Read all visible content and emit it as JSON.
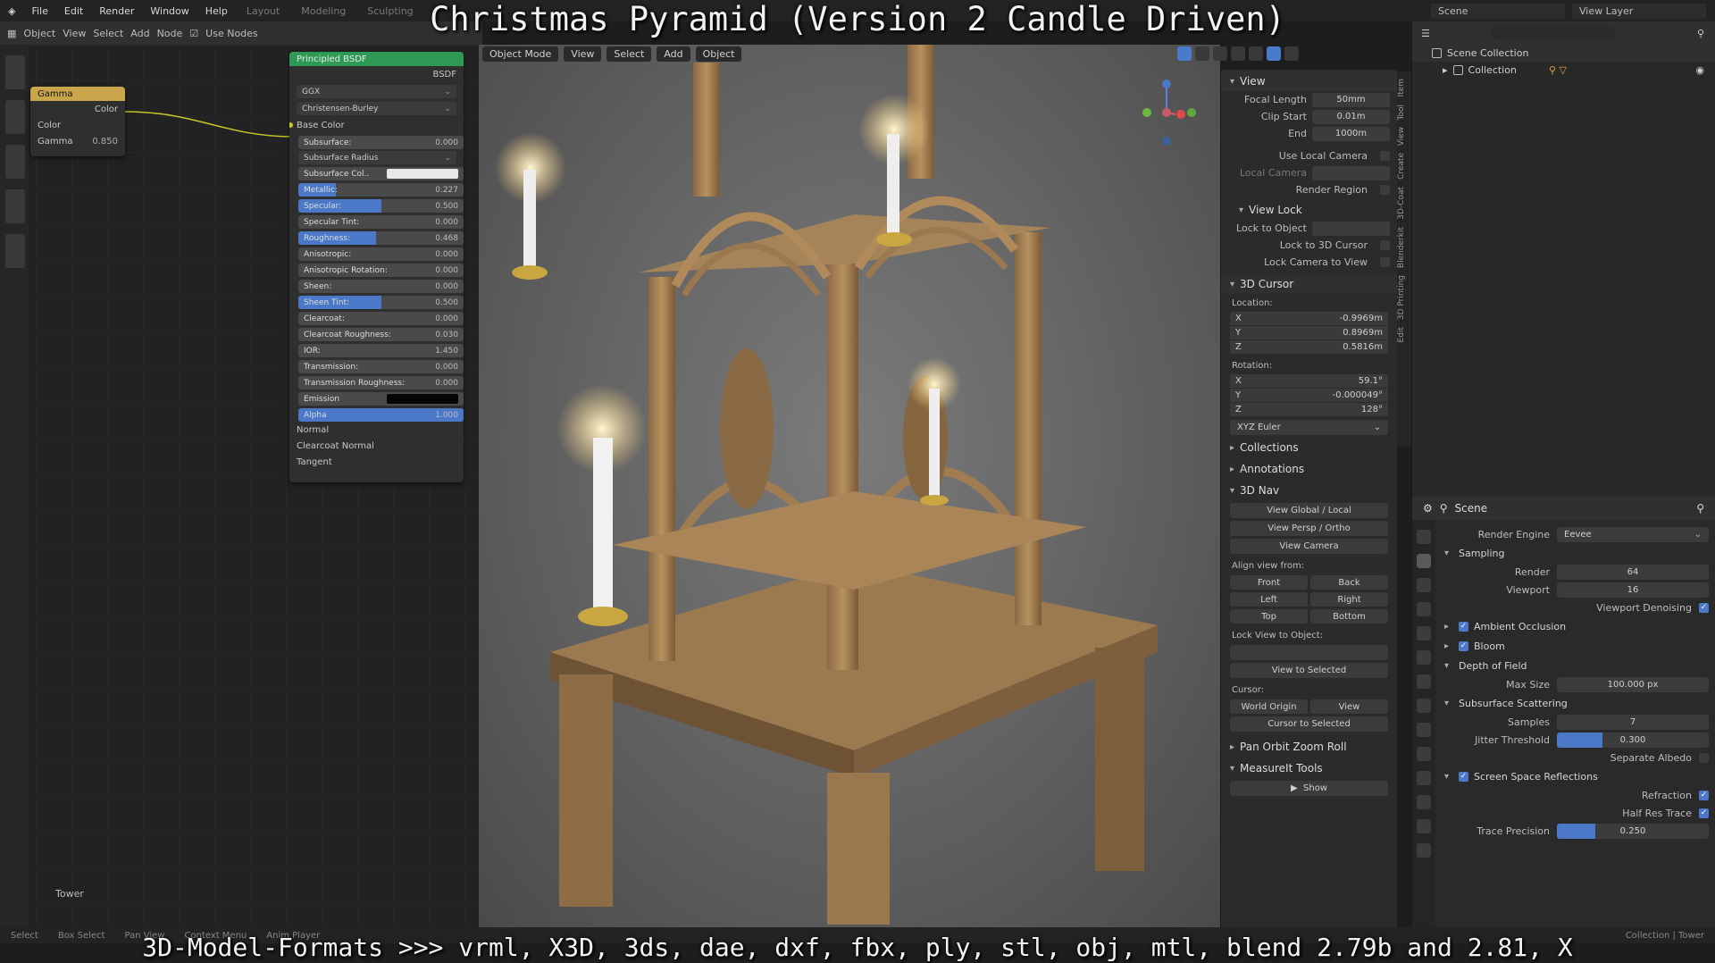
{
  "overlay": {
    "title": "Christmas Pyramid (Version 2 Candle Driven)",
    "caption": "3D-Model-Formats >>> vrml, X3D, 3ds, dae, dxf, fbx, ply, stl, obj, mtl, blend 2.79b and 2.81, X"
  },
  "topbar": {
    "menu": [
      "File",
      "Edit",
      "Render",
      "Window",
      "Help"
    ],
    "workspaces": [
      "Layout",
      "Modeling",
      "Sculpting"
    ],
    "scene": "Scene",
    "view_layer": "View Layer"
  },
  "node_editor": {
    "header": [
      "Object",
      "View",
      "Select",
      "Add",
      "Node",
      "Use Nodes"
    ],
    "gamma_node": {
      "title": "Gamma",
      "output": "Color",
      "input": "Color",
      "gamma_label": "Gamma",
      "gamma_value": "0.850"
    },
    "bsdf_node": {
      "title": "Principled BSDF",
      "output": "BSDF",
      "distribution": "GGX",
      "subsurface_method": "Christensen-Burley",
      "base_color": "Base Color",
      "rows": [
        {
          "label": "Subsurface:",
          "value": "0.000",
          "fill": 0
        },
        {
          "label": "Subsurface Col..",
          "value": "",
          "fill": 0
        },
        {
          "label": "Metallic:",
          "value": "0.227",
          "fill": 0.227
        },
        {
          "label": "Specular:",
          "value": "0.500",
          "fill": 0.5
        },
        {
          "label": "Specular Tint:",
          "value": "0.000",
          "fill": 0
        },
        {
          "label": "Roughness:",
          "value": "0.468",
          "fill": 0.468
        },
        {
          "label": "Anisotropic:",
          "value": "0.000",
          "fill": 0
        },
        {
          "label": "Anisotropic Rotation:",
          "value": "0.000",
          "fill": 0
        },
        {
          "label": "Sheen:",
          "value": "0.000",
          "fill": 0
        },
        {
          "label": "Sheen Tint:",
          "value": "0.500",
          "fill": 0.5
        },
        {
          "label": "Clearcoat:",
          "value": "0.000",
          "fill": 0
        },
        {
          "label": "Clearcoat Roughness:",
          "value": "0.030",
          "fill": 0
        },
        {
          "label": "IOR:",
          "value": "1.450",
          "fill": 0
        },
        {
          "label": "Transmission:",
          "value": "0.000",
          "fill": 0
        },
        {
          "label": "Transmission Roughness:",
          "value": "0.000",
          "fill": 0
        },
        {
          "label": "Emission",
          "value": "",
          "fill": 0
        },
        {
          "label": "Alpha",
          "value": "1.000",
          "fill": 1
        }
      ],
      "subsurface_radius": "Subsurface Radius",
      "normal": "Normal",
      "clearcoat_normal": "Clearcoat Normal",
      "tangent": "Tangent"
    },
    "object_label": "Tower"
  },
  "viewport": {
    "mode": "Object Mode",
    "menu": [
      "View",
      "Select",
      "Add",
      "Object"
    ]
  },
  "n_panel": {
    "tabs": [
      "Item",
      "Tool",
      "View",
      "Create",
      "3D-Coat",
      "Blenderkit",
      "3D Printing",
      "Edit"
    ],
    "view_header": "View",
    "focal_length_label": "Focal Length",
    "focal_length": "50mm",
    "clip_start_label": "Clip Start",
    "clip_start": "0.01m",
    "clip_end_label": "End",
    "clip_end": "1000m",
    "use_local_camera": "Use Local Camera",
    "local_camera": "Local Camera",
    "render_region": "Render Region",
    "view_lock_header": "View Lock",
    "lock_to_object": "Lock to Object",
    "lock_to_cursor": "Lock to 3D Cursor",
    "lock_camera": "Lock Camera to View",
    "cursor_header": "3D Cursor",
    "location_label": "Location:",
    "location": [
      {
        "axis": "X",
        "value": "-0.9969m"
      },
      {
        "axis": "Y",
        "value": "0.8969m"
      },
      {
        "axis": "Z",
        "value": "0.5816m"
      }
    ],
    "rotation_label": "Rotation:",
    "rotation": [
      {
        "axis": "X",
        "value": "59.1°"
      },
      {
        "axis": "Y",
        "value": "-0.000049°"
      },
      {
        "axis": "Z",
        "value": "128°"
      }
    ],
    "rotation_mode": "XYZ Euler",
    "collections": "Collections",
    "annotations": "Annotations",
    "nav_header": "3D Nav",
    "view_global_local": "View Global / Local",
    "view_persp_ortho": "View Persp / Ortho",
    "view_camera": "View Camera",
    "align_from": "Align view from:",
    "align_buttons": [
      "Front",
      "Back",
      "Left",
      "Right",
      "Top",
      "Bottom"
    ],
    "lock_view_to_object": "Lock View to Object:",
    "view_to_selected": "View to Selected",
    "cursor_label": "Cursor:",
    "world_origin": "World Origin",
    "cursor_view": "View",
    "cursor_to_selected": "Cursor to Selected",
    "pan_orbit": "Pan Orbit Zoom Roll",
    "measureit": "MeasureIt Tools",
    "show": "Show"
  },
  "outliner": {
    "scene_collection": "Scene Collection",
    "collection": "Collection"
  },
  "properties": {
    "header": "Scene",
    "render_engine_label": "Render Engine",
    "render_engine": "Eevee",
    "sampling": "Sampling",
    "render_label": "Render",
    "render_samples": "64",
    "viewport_label": "Viewport",
    "viewport_samples": "16",
    "viewport_denoising": "Viewport Denoising",
    "ambient_occlusion": "Ambient Occlusion",
    "bloom": "Bloom",
    "depth_of_field": "Depth of Field",
    "max_size_label": "Max Size",
    "max_size": "100.000 px",
    "sss": "Subsurface Scattering",
    "samples_label": "Samples",
    "samples": "7",
    "jitter_label": "Jitter Threshold",
    "jitter": "0.300",
    "jitter_fill": 0.3,
    "separate_albedo": "Separate Albedo",
    "ssr": "Screen Space Reflections",
    "refraction": "Refraction",
    "half_res": "Half Res Trace",
    "trace_precision_label": "Trace Precision",
    "trace_precision": "0.250",
    "trace_fill": 0.25
  },
  "statusbar": {
    "items": [
      "Select",
      "Box Select",
      "Pan View",
      "Context Menu",
      "Anim Player"
    ],
    "stats": "Collection | Tower"
  },
  "colors": {
    "accent": "#4b79c8",
    "gamma_header": "#c9a64c",
    "bsdf_header": "#2f9a55"
  }
}
